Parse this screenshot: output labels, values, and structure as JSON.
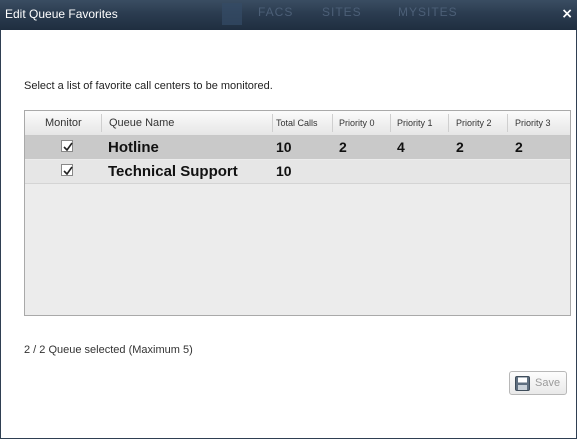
{
  "dialog": {
    "title": "Edit Queue Favorites",
    "ghost_text": [
      "FACS",
      "SITES",
      "MYSITES"
    ],
    "close_label": "×"
  },
  "instruction": "Select a list of favorite call centers to be monitored.",
  "table": {
    "headers": {
      "monitor": "Monitor",
      "queue_name": "Queue Name",
      "total_calls": "Total Calls",
      "priority0": "Priority 0",
      "priority1": "Priority 1",
      "priority2": "Priority 2",
      "priority3": "Priority 3"
    },
    "rows": [
      {
        "monitored": true,
        "name": "Hotline",
        "total_calls": "10",
        "priority0": "2",
        "priority1": "4",
        "priority2": "2",
        "priority3": "2"
      },
      {
        "monitored": true,
        "name": "Technical Support",
        "total_calls": "10",
        "priority0": "",
        "priority1": "",
        "priority2": "",
        "priority3": ""
      }
    ]
  },
  "status": "2 / 2 Queue selected (Maximum 5)",
  "save": {
    "label": "Save",
    "icon": "floppy-disk-icon",
    "enabled": false
  },
  "colors": {
    "titlebar": "#2b3c50",
    "selected_row": "#c9c9c9",
    "table_bg": "#ececec"
  }
}
